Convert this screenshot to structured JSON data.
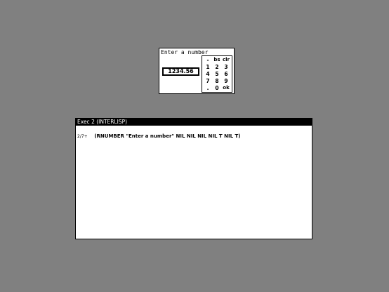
{
  "numpad": {
    "title": "Enter a number",
    "value": "1234.56",
    "keys": [
      [
        "-",
        "bs",
        "clr"
      ],
      [
        "1",
        "2",
        "3"
      ],
      [
        "4",
        "5",
        "6"
      ],
      [
        "7",
        "8",
        "9"
      ],
      [
        ".",
        "0",
        "ok"
      ]
    ]
  },
  "exec": {
    "title": "Exec 2 (INTERLISP)",
    "prompt": "2/7+",
    "command": "(RNUMBER \"Enter a number\" NIL NIL NIL NIL T NIL T)"
  }
}
